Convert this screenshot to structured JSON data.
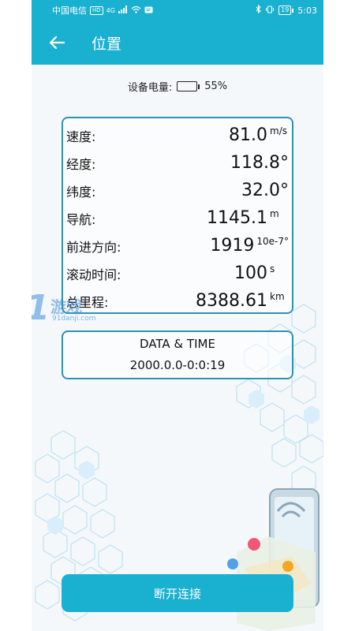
{
  "status_bar": {
    "carrier": "中国电信",
    "hd_chip": "HD",
    "network": "4G",
    "battery_level": "19",
    "time": "5:03"
  },
  "app_bar": {
    "title": "位置",
    "back_icon": "arrow-left-icon"
  },
  "device_battery": {
    "label": "设备电量:",
    "percent_text": "55%",
    "level_fraction": 0.55,
    "fill_color": "#36c43c"
  },
  "readings": [
    {
      "label": "速度:",
      "value": "81.0",
      "unit": "m/s"
    },
    {
      "label": "经度:",
      "value": "118.8°",
      "unit": ""
    },
    {
      "label": "纬度:",
      "value": "32.0°",
      "unit": ""
    },
    {
      "label": "导航:",
      "value": "1145.1",
      "unit": "m"
    },
    {
      "label": "前进方向:",
      "value": "1919",
      "unit": "10e-7°"
    },
    {
      "label": "滚动时间:",
      "value": "100",
      "unit": "s"
    },
    {
      "label": "总里程:",
      "value": "8388.61",
      "unit": "km"
    }
  ],
  "datetime": {
    "heading": "DATA & TIME",
    "value": "2000.0.0-0:0:19"
  },
  "disconnect_button": {
    "label": "断开连接"
  },
  "watermark": {
    "number": "91",
    "name": "游戏",
    "url": "91danji.com"
  },
  "colors": {
    "primary": "#1ab0cf",
    "border": "#2e93ad"
  }
}
